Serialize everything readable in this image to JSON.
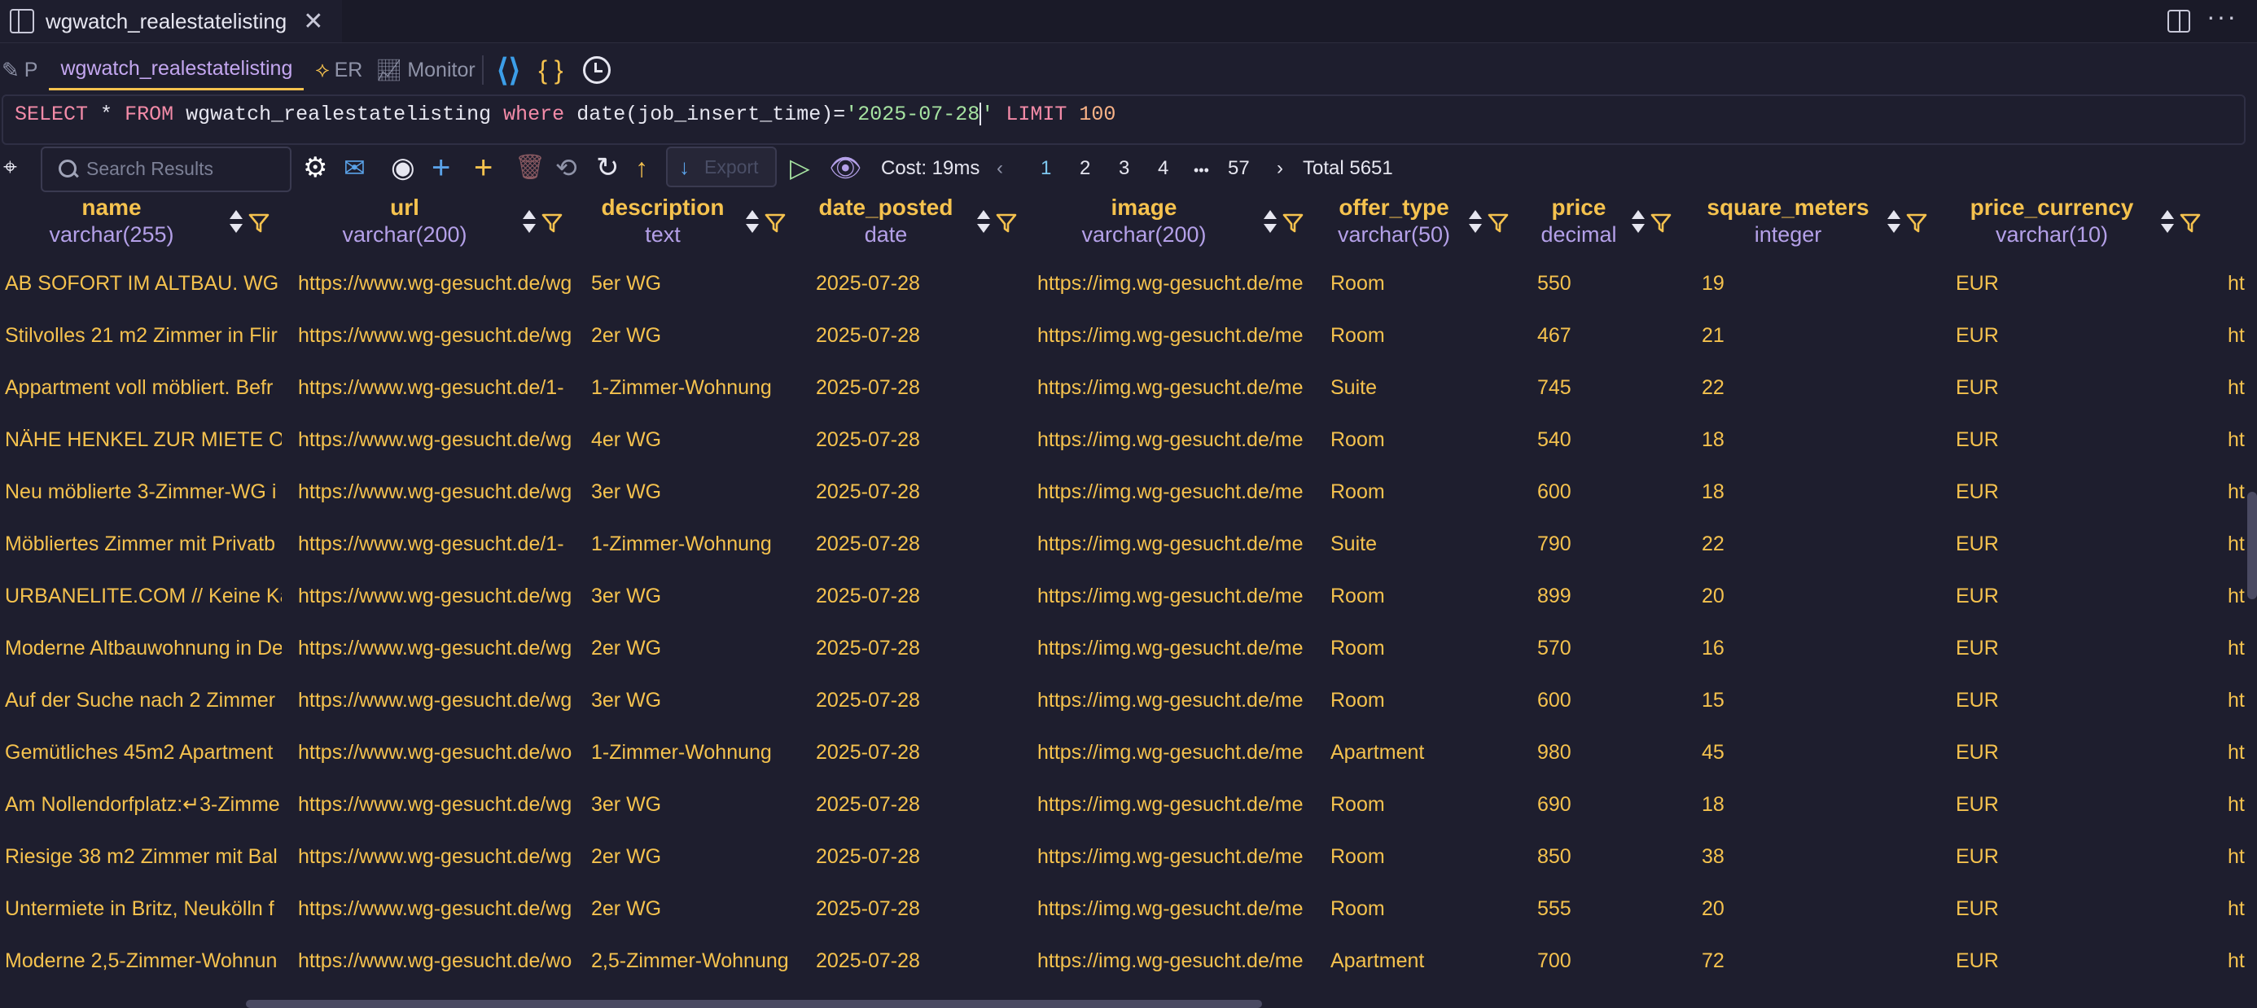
{
  "window": {
    "tab_title": "wgwatch_realestatelisting"
  },
  "subtabs": {
    "partial_label": "P",
    "query_label": "wgwatch_realestatelisting",
    "er_label": "ER",
    "monitor_label": "Monitor",
    "braces_glyph": "{ }"
  },
  "sql": {
    "select": "SELECT",
    "star": "*",
    "from": "FROM",
    "table": "wgwatch_realestatelisting",
    "where": "where",
    "expr": "date(job_insert_time)=",
    "date_lit": "'2025-07-28",
    "date_close": "'",
    "limit": "LIMIT",
    "limit_val": "100"
  },
  "toolbar": {
    "search_placeholder": "Search Results",
    "export_label": "Export",
    "cost": "Cost: 19ms",
    "pages": [
      "1",
      "2",
      "3",
      "4",
      "•••",
      "57"
    ],
    "total": "Total 5651"
  },
  "columns": [
    {
      "name": "name",
      "type": "varchar(255)"
    },
    {
      "name": "url",
      "type": "varchar(200)"
    },
    {
      "name": "description",
      "type": "text"
    },
    {
      "name": "date_posted",
      "type": "date"
    },
    {
      "name": "image",
      "type": "varchar(200)"
    },
    {
      "name": "offer_type",
      "type": "varchar(50)"
    },
    {
      "name": "price",
      "type": "decimal"
    },
    {
      "name": "square_meters",
      "type": "integer"
    },
    {
      "name": "price_currency",
      "type": "varchar(10)"
    }
  ],
  "rows": [
    [
      "AB SOFORT IM ALTBAU. WG Z",
      "https://www.wg-gesucht.de/wg",
      "5er WG",
      "2025-07-28",
      "https://img.wg-gesucht.de/me",
      "Room",
      "550",
      "19",
      "EUR",
      "ht"
    ],
    [
      "Stilvolles 21 m2 Zimmer in Flir",
      "https://www.wg-gesucht.de/wg",
      "2er WG",
      "2025-07-28",
      "https://img.wg-gesucht.de/me",
      "Room",
      "467",
      "21",
      "EUR",
      "ht"
    ],
    [
      "Appartment voll möbliert. Befr",
      "https://www.wg-gesucht.de/1-",
      "1-Zimmer-Wohnung",
      "2025-07-28",
      "https://img.wg-gesucht.de/me",
      "Suite",
      "745",
      "22",
      "EUR",
      "ht"
    ],
    [
      "NÄHE HENKEL ZUR MIETE OD",
      "https://www.wg-gesucht.de/wg",
      "4er WG",
      "2025-07-28",
      "https://img.wg-gesucht.de/me",
      "Room",
      "540",
      "18",
      "EUR",
      "ht"
    ],
    [
      "Neu möblierte 3-Zimmer-WG i",
      "https://www.wg-gesucht.de/wg",
      "3er WG",
      "2025-07-28",
      "https://img.wg-gesucht.de/me",
      "Room",
      "600",
      "18",
      "EUR",
      "ht"
    ],
    [
      "Möbliertes Zimmer mit Privatb",
      "https://www.wg-gesucht.de/1-",
      "1-Zimmer-Wohnung",
      "2025-07-28",
      "https://img.wg-gesucht.de/me",
      "Suite",
      "790",
      "22",
      "EUR",
      "ht"
    ],
    [
      "URBANELITE.COM // Keine Kau",
      "https://www.wg-gesucht.de/wg",
      "3er WG",
      "2025-07-28",
      "https://img.wg-gesucht.de/me",
      "Room",
      "899",
      "20",
      "EUR",
      "ht"
    ],
    [
      "Moderne Altbauwohnung in De",
      "https://www.wg-gesucht.de/wg",
      "2er WG",
      "2025-07-28",
      "https://img.wg-gesucht.de/me",
      "Room",
      "570",
      "16",
      "EUR",
      "ht"
    ],
    [
      "Auf der Suche nach 2 Zimmer",
      "https://www.wg-gesucht.de/wg",
      "3er WG",
      "2025-07-28",
      "https://img.wg-gesucht.de/me",
      "Room",
      "600",
      "15",
      "EUR",
      "ht"
    ],
    [
      "Gemütliches 45m2 Apartment",
      "https://www.wg-gesucht.de/wo",
      "1-Zimmer-Wohnung",
      "2025-07-28",
      "https://img.wg-gesucht.de/me",
      "Apartment",
      "980",
      "45",
      "EUR",
      "ht"
    ],
    [
      "Am Nollendorfplatz:↵3-Zimme",
      "https://www.wg-gesucht.de/wg",
      "3er WG",
      "2025-07-28",
      "https://img.wg-gesucht.de/me",
      "Room",
      "690",
      "18",
      "EUR",
      "ht"
    ],
    [
      "Riesige 38 m2 Zimmer mit Bal",
      "https://www.wg-gesucht.de/wg",
      "2er WG",
      "2025-07-28",
      "https://img.wg-gesucht.de/me",
      "Room",
      "850",
      "38",
      "EUR",
      "ht"
    ],
    [
      "Untermiete in Britz, Neukölln f",
      "https://www.wg-gesucht.de/wg",
      "2er WG",
      "2025-07-28",
      "https://img.wg-gesucht.de/me",
      "Room",
      "555",
      "20",
      "EUR",
      "ht"
    ],
    [
      "Moderne 2,5-Zimmer-Wohnun",
      "https://www.wg-gesucht.de/wo",
      "2,5-Zimmer-Wohnung",
      "2025-07-28",
      "https://img.wg-gesucht.de/me",
      "Apartment",
      "700",
      "72",
      "EUR",
      "ht"
    ]
  ]
}
